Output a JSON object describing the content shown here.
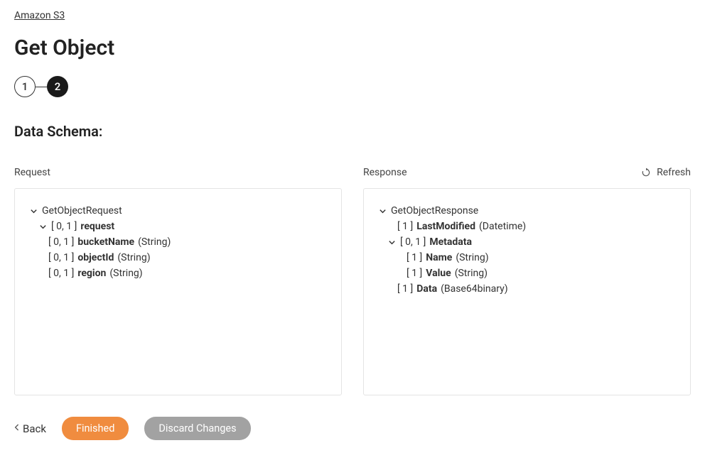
{
  "breadcrumb": "Amazon S3",
  "page_title": "Get Object",
  "steps": {
    "s1": "1",
    "s2": "2"
  },
  "section_heading": "Data Schema:",
  "request": {
    "title": "Request",
    "root": "GetObjectRequest",
    "child": {
      "card": "[ 0, 1 ]",
      "name": "request"
    },
    "fields": {
      "f0": {
        "card": "[ 0, 1 ]",
        "name": "bucketName",
        "type": "(String)"
      },
      "f1": {
        "card": "[ 0, 1 ]",
        "name": "objectId",
        "type": "(String)"
      },
      "f2": {
        "card": "[ 0, 1 ]",
        "name": "region",
        "type": "(String)"
      }
    }
  },
  "response": {
    "title": "Response",
    "refresh": "Refresh",
    "root": "GetObjectResponse",
    "lastmod": {
      "card": "[ 1 ]",
      "name": "LastModified",
      "type": "(Datetime)"
    },
    "metadata": {
      "card": "[ 0, 1 ]",
      "name": "Metadata"
    },
    "meta_fields": {
      "f0": {
        "card": "[ 1 ]",
        "name": "Name",
        "type": "(String)"
      },
      "f1": {
        "card": "[ 1 ]",
        "name": "Value",
        "type": "(String)"
      }
    },
    "data": {
      "card": "[ 1 ]",
      "name": "Data",
      "type": "(Base64binary)"
    }
  },
  "footer": {
    "back": "Back",
    "finished": "Finished",
    "discard": "Discard Changes"
  }
}
